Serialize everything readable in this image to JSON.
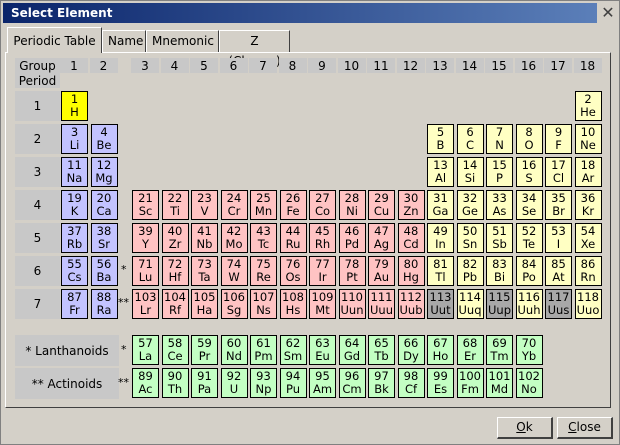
{
  "window": {
    "title": "Select Element",
    "close_glyph": "✕"
  },
  "tabs": [
    {
      "label": "Periodic Table",
      "active": true
    },
    {
      "label": "Name",
      "active": false
    },
    {
      "label": "Mnemonic",
      "active": false
    },
    {
      "label": "Z (Charge)",
      "active": false
    }
  ],
  "table": {
    "group_label": "Group",
    "period_label": "Period",
    "groups": [
      "1",
      "2",
      "3",
      "4",
      "5",
      "6",
      "7",
      "8",
      "9",
      "10",
      "11",
      "12",
      "13",
      "14",
      "15",
      "16",
      "17",
      "18"
    ],
    "periods": [
      "1",
      "2",
      "3",
      "4",
      "5",
      "6",
      "7"
    ],
    "star_lanthanoid": "*",
    "star_actinoid": "**",
    "lanthanoids_label": "* Lanthanoids",
    "actinoids_label": "** Actinoids",
    "colors": {
      "s": "#c3c3ff",
      "d": "#ffc3c3",
      "p": "#ffffc3",
      "f": "#c3ffc3",
      "selected": "#ffff00",
      "unknown": "#a8a8a8"
    },
    "elements": [
      {
        "z": "1",
        "sym": "H",
        "g": 1,
        "p": 1,
        "t": "selected"
      },
      {
        "z": "2",
        "sym": "He",
        "g": 18,
        "p": 1,
        "t": "p"
      },
      {
        "z": "3",
        "sym": "Li",
        "g": 1,
        "p": 2,
        "t": "s"
      },
      {
        "z": "4",
        "sym": "Be",
        "g": 2,
        "p": 2,
        "t": "s"
      },
      {
        "z": "5",
        "sym": "B",
        "g": 13,
        "p": 2,
        "t": "p"
      },
      {
        "z": "6",
        "sym": "C",
        "g": 14,
        "p": 2,
        "t": "p"
      },
      {
        "z": "7",
        "sym": "N",
        "g": 15,
        "p": 2,
        "t": "p"
      },
      {
        "z": "8",
        "sym": "O",
        "g": 16,
        "p": 2,
        "t": "p"
      },
      {
        "z": "9",
        "sym": "F",
        "g": 17,
        "p": 2,
        "t": "p"
      },
      {
        "z": "10",
        "sym": "Ne",
        "g": 18,
        "p": 2,
        "t": "p"
      },
      {
        "z": "11",
        "sym": "Na",
        "g": 1,
        "p": 3,
        "t": "s"
      },
      {
        "z": "12",
        "sym": "Mg",
        "g": 2,
        "p": 3,
        "t": "s"
      },
      {
        "z": "13",
        "sym": "Al",
        "g": 13,
        "p": 3,
        "t": "p"
      },
      {
        "z": "14",
        "sym": "Si",
        "g": 14,
        "p": 3,
        "t": "p"
      },
      {
        "z": "15",
        "sym": "P",
        "g": 15,
        "p": 3,
        "t": "p"
      },
      {
        "z": "16",
        "sym": "S",
        "g": 16,
        "p": 3,
        "t": "p"
      },
      {
        "z": "17",
        "sym": "Cl",
        "g": 17,
        "p": 3,
        "t": "p"
      },
      {
        "z": "18",
        "sym": "Ar",
        "g": 18,
        "p": 3,
        "t": "p"
      },
      {
        "z": "19",
        "sym": "K",
        "g": 1,
        "p": 4,
        "t": "s"
      },
      {
        "z": "20",
        "sym": "Ca",
        "g": 2,
        "p": 4,
        "t": "s"
      },
      {
        "z": "21",
        "sym": "Sc",
        "g": 3,
        "p": 4,
        "t": "d"
      },
      {
        "z": "22",
        "sym": "Ti",
        "g": 4,
        "p": 4,
        "t": "d"
      },
      {
        "z": "23",
        "sym": "V",
        "g": 5,
        "p": 4,
        "t": "d"
      },
      {
        "z": "24",
        "sym": "Cr",
        "g": 6,
        "p": 4,
        "t": "d"
      },
      {
        "z": "25",
        "sym": "Mn",
        "g": 7,
        "p": 4,
        "t": "d"
      },
      {
        "z": "26",
        "sym": "Fe",
        "g": 8,
        "p": 4,
        "t": "d"
      },
      {
        "z": "27",
        "sym": "Co",
        "g": 9,
        "p": 4,
        "t": "d"
      },
      {
        "z": "28",
        "sym": "Ni",
        "g": 10,
        "p": 4,
        "t": "d"
      },
      {
        "z": "29",
        "sym": "Cu",
        "g": 11,
        "p": 4,
        "t": "d"
      },
      {
        "z": "30",
        "sym": "Zn",
        "g": 12,
        "p": 4,
        "t": "d"
      },
      {
        "z": "31",
        "sym": "Ga",
        "g": 13,
        "p": 4,
        "t": "p"
      },
      {
        "z": "32",
        "sym": "Ge",
        "g": 14,
        "p": 4,
        "t": "p"
      },
      {
        "z": "33",
        "sym": "As",
        "g": 15,
        "p": 4,
        "t": "p"
      },
      {
        "z": "34",
        "sym": "Se",
        "g": 16,
        "p": 4,
        "t": "p"
      },
      {
        "z": "35",
        "sym": "Br",
        "g": 17,
        "p": 4,
        "t": "p"
      },
      {
        "z": "36",
        "sym": "Kr",
        "g": 18,
        "p": 4,
        "t": "p"
      },
      {
        "z": "37",
        "sym": "Rb",
        "g": 1,
        "p": 5,
        "t": "s"
      },
      {
        "z": "38",
        "sym": "Sr",
        "g": 2,
        "p": 5,
        "t": "s"
      },
      {
        "z": "39",
        "sym": "Y",
        "g": 3,
        "p": 5,
        "t": "d"
      },
      {
        "z": "40",
        "sym": "Zr",
        "g": 4,
        "p": 5,
        "t": "d"
      },
      {
        "z": "41",
        "sym": "Nb",
        "g": 5,
        "p": 5,
        "t": "d"
      },
      {
        "z": "42",
        "sym": "Mo",
        "g": 6,
        "p": 5,
        "t": "d"
      },
      {
        "z": "43",
        "sym": "Tc",
        "g": 7,
        "p": 5,
        "t": "d"
      },
      {
        "z": "44",
        "sym": "Ru",
        "g": 8,
        "p": 5,
        "t": "d"
      },
      {
        "z": "45",
        "sym": "Rh",
        "g": 9,
        "p": 5,
        "t": "d"
      },
      {
        "z": "46",
        "sym": "Pd",
        "g": 10,
        "p": 5,
        "t": "d"
      },
      {
        "z": "47",
        "sym": "Ag",
        "g": 11,
        "p": 5,
        "t": "d"
      },
      {
        "z": "48",
        "sym": "Cd",
        "g": 12,
        "p": 5,
        "t": "d"
      },
      {
        "z": "49",
        "sym": "In",
        "g": 13,
        "p": 5,
        "t": "p"
      },
      {
        "z": "50",
        "sym": "Sn",
        "g": 14,
        "p": 5,
        "t": "p"
      },
      {
        "z": "51",
        "sym": "Sb",
        "g": 15,
        "p": 5,
        "t": "p"
      },
      {
        "z": "52",
        "sym": "Te",
        "g": 16,
        "p": 5,
        "t": "p"
      },
      {
        "z": "53",
        "sym": "I",
        "g": 17,
        "p": 5,
        "t": "p"
      },
      {
        "z": "54",
        "sym": "Xe",
        "g": 18,
        "p": 5,
        "t": "p"
      },
      {
        "z": "55",
        "sym": "Cs",
        "g": 1,
        "p": 6,
        "t": "s"
      },
      {
        "z": "56",
        "sym": "Ba",
        "g": 2,
        "p": 6,
        "t": "s"
      },
      {
        "z": "71",
        "sym": "Lu",
        "g": 3,
        "p": 6,
        "t": "d"
      },
      {
        "z": "72",
        "sym": "Hf",
        "g": 4,
        "p": 6,
        "t": "d"
      },
      {
        "z": "73",
        "sym": "Ta",
        "g": 5,
        "p": 6,
        "t": "d"
      },
      {
        "z": "74",
        "sym": "W",
        "g": 6,
        "p": 6,
        "t": "d"
      },
      {
        "z": "75",
        "sym": "Re",
        "g": 7,
        "p": 6,
        "t": "d"
      },
      {
        "z": "76",
        "sym": "Os",
        "g": 8,
        "p": 6,
        "t": "d"
      },
      {
        "z": "77",
        "sym": "Ir",
        "g": 9,
        "p": 6,
        "t": "d"
      },
      {
        "z": "78",
        "sym": "Pt",
        "g": 10,
        "p": 6,
        "t": "d"
      },
      {
        "z": "79",
        "sym": "Au",
        "g": 11,
        "p": 6,
        "t": "d"
      },
      {
        "z": "80",
        "sym": "Hg",
        "g": 12,
        "p": 6,
        "t": "d"
      },
      {
        "z": "81",
        "sym": "Tl",
        "g": 13,
        "p": 6,
        "t": "p"
      },
      {
        "z": "82",
        "sym": "Pb",
        "g": 14,
        "p": 6,
        "t": "p"
      },
      {
        "z": "83",
        "sym": "Bi",
        "g": 15,
        "p": 6,
        "t": "p"
      },
      {
        "z": "84",
        "sym": "Po",
        "g": 16,
        "p": 6,
        "t": "p"
      },
      {
        "z": "85",
        "sym": "At",
        "g": 17,
        "p": 6,
        "t": "p"
      },
      {
        "z": "86",
        "sym": "Rn",
        "g": 18,
        "p": 6,
        "t": "p"
      },
      {
        "z": "87",
        "sym": "Fr",
        "g": 1,
        "p": 7,
        "t": "s"
      },
      {
        "z": "88",
        "sym": "Ra",
        "g": 2,
        "p": 7,
        "t": "s"
      },
      {
        "z": "103",
        "sym": "Lr",
        "g": 3,
        "p": 7,
        "t": "d"
      },
      {
        "z": "104",
        "sym": "Rf",
        "g": 4,
        "p": 7,
        "t": "d"
      },
      {
        "z": "105",
        "sym": "Ha",
        "g": 5,
        "p": 7,
        "t": "d"
      },
      {
        "z": "106",
        "sym": "Sg",
        "g": 6,
        "p": 7,
        "t": "d"
      },
      {
        "z": "107",
        "sym": "Ns",
        "g": 7,
        "p": 7,
        "t": "d"
      },
      {
        "z": "108",
        "sym": "Hs",
        "g": 8,
        "p": 7,
        "t": "d"
      },
      {
        "z": "109",
        "sym": "Mt",
        "g": 9,
        "p": 7,
        "t": "d"
      },
      {
        "z": "110",
        "sym": "Uun",
        "g": 10,
        "p": 7,
        "t": "d"
      },
      {
        "z": "111",
        "sym": "Uuu",
        "g": 11,
        "p": 7,
        "t": "d"
      },
      {
        "z": "112",
        "sym": "Uub",
        "g": 12,
        "p": 7,
        "t": "d"
      },
      {
        "z": "113",
        "sym": "Uut",
        "g": 13,
        "p": 7,
        "t": "unknown"
      },
      {
        "z": "114",
        "sym": "Uuq",
        "g": 14,
        "p": 7,
        "t": "p"
      },
      {
        "z": "115",
        "sym": "Uup",
        "g": 15,
        "p": 7,
        "t": "unknown"
      },
      {
        "z": "116",
        "sym": "Uuh",
        "g": 16,
        "p": 7,
        "t": "p"
      },
      {
        "z": "117",
        "sym": "Uus",
        "g": 17,
        "p": 7,
        "t": "unknown"
      },
      {
        "z": "118",
        "sym": "Uuo",
        "g": 18,
        "p": 7,
        "t": "p"
      }
    ],
    "lanthanoids": [
      {
        "z": "57",
        "sym": "La"
      },
      {
        "z": "58",
        "sym": "Ce"
      },
      {
        "z": "59",
        "sym": "Pr"
      },
      {
        "z": "60",
        "sym": "Nd"
      },
      {
        "z": "61",
        "sym": "Pm"
      },
      {
        "z": "62",
        "sym": "Sm"
      },
      {
        "z": "63",
        "sym": "Eu"
      },
      {
        "z": "64",
        "sym": "Gd"
      },
      {
        "z": "65",
        "sym": "Tb"
      },
      {
        "z": "66",
        "sym": "Dy"
      },
      {
        "z": "67",
        "sym": "Ho"
      },
      {
        "z": "68",
        "sym": "Er"
      },
      {
        "z": "69",
        "sym": "Tm"
      },
      {
        "z": "70",
        "sym": "Yb"
      }
    ],
    "actinoids": [
      {
        "z": "89",
        "sym": "Ac"
      },
      {
        "z": "90",
        "sym": "Th"
      },
      {
        "z": "91",
        "sym": "Pa"
      },
      {
        "z": "92",
        "sym": "U"
      },
      {
        "z": "93",
        "sym": "Np"
      },
      {
        "z": "94",
        "sym": "Pu"
      },
      {
        "z": "95",
        "sym": "Am"
      },
      {
        "z": "96",
        "sym": "Cm"
      },
      {
        "z": "97",
        "sym": "Bk"
      },
      {
        "z": "98",
        "sym": "Cf"
      },
      {
        "z": "99",
        "sym": "Es"
      },
      {
        "z": "100",
        "sym": "Fm"
      },
      {
        "z": "101",
        "sym": "Md"
      },
      {
        "z": "102",
        "sym": "No"
      }
    ]
  },
  "buttons": {
    "ok": {
      "mnemonic": "O",
      "rest": "k"
    },
    "close": {
      "mnemonic": "C",
      "rest": "lose"
    }
  }
}
